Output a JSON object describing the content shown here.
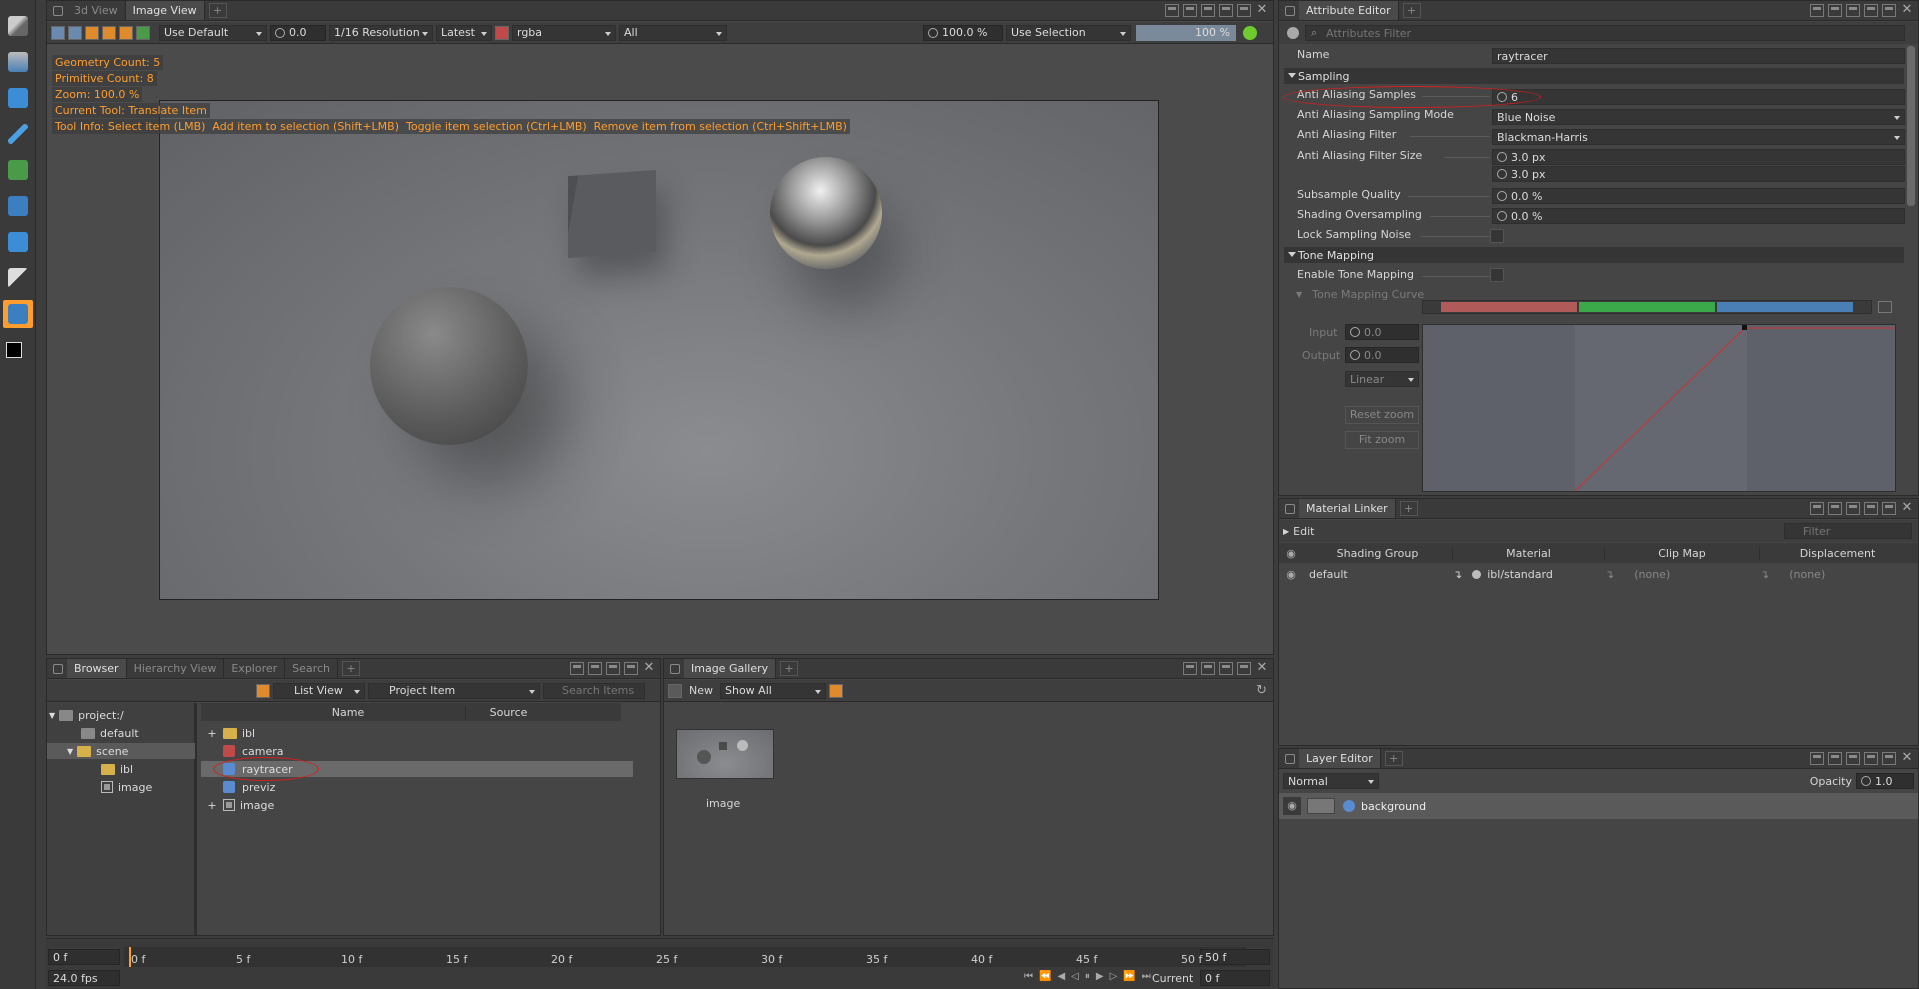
{
  "viewer": {
    "tabs": [
      "3d View",
      "Image View"
    ],
    "active_tab": "Image View",
    "toolbar": {
      "lut": "Use Default",
      "exposure": "0.0",
      "resolution": "1/16 Resolution",
      "version": "Latest",
      "channel": "rgba",
      "layer": "All",
      "zoom": "100.0 %",
      "selection": "Use Selection",
      "progress_label": "100 %",
      "progress": 1.0
    },
    "hud": {
      "geometry": "Geometry Count: 5",
      "primitive": "Primitive Count: 8",
      "zoom": "Zoom: 100.0 %",
      "current_tool": "Current Tool: Translate Item",
      "tool_info": "Tool Info: Select item (LMB)  Add item to selection (Shift+LMB)  Toggle item selection (Ctrl+LMB)  Remove item from selection (Ctrl+Shift+LMB)"
    }
  },
  "attribute_editor": {
    "title": "Attribute Editor",
    "filter_placeholder": "Attributes Filter",
    "name_label": "Name",
    "name_value": "raytracer",
    "sampling_section": "Sampling",
    "rows": [
      {
        "label": "Anti Aliasing Samples",
        "value": "6"
      },
      {
        "label": "Anti Aliasing Sampling Mode",
        "value": "Blue Noise"
      },
      {
        "label": "Anti Aliasing Filter",
        "value": "Blackman-Harris"
      },
      {
        "label": "Anti Aliasing Filter Size",
        "value": "3.0 px",
        "value2": "3.0 px"
      },
      {
        "label": "Subsample Quality",
        "value": "0.0 %"
      },
      {
        "label": "Shading Oversampling",
        "value": "0.0 %"
      },
      {
        "label": "Lock Sampling Noise"
      }
    ],
    "tone_section": "Tone Mapping",
    "enable_tone": "Enable Tone Mapping",
    "curve_section": "Tone Mapping Curve",
    "input_label": "Input",
    "input_value": "0.0",
    "output_label": "Output",
    "output_value": "0.0",
    "interp": "Linear",
    "reset_zoom": "Reset zoom",
    "fit_zoom": "Fit zoom",
    "colors": {
      "red": "#b05a5a",
      "green": "#3ba84a",
      "blue": "#4a7fb6"
    }
  },
  "material_linker": {
    "title": "Material Linker",
    "edit": "Edit",
    "filter_placeholder": "Filter",
    "headers": [
      "Shading Group",
      "Material",
      "Clip Map",
      "Displacement"
    ],
    "row": {
      "group": "default",
      "material": "ibl/standard",
      "clip": "(none)",
      "disp": "(none)"
    }
  },
  "layer_editor": {
    "title": "Layer Editor",
    "mode": "Normal",
    "opacity_label": "Opacity",
    "opacity": "1.0",
    "layer": "background"
  },
  "browser": {
    "tabs": [
      "Browser",
      "Hierarchy View",
      "Explorer",
      "Search"
    ],
    "view": "List View",
    "filter": "Project Item",
    "search_placeholder": "Search Items",
    "tree": [
      {
        "label": "project:/",
        "depth": 0
      },
      {
        "label": "default",
        "depth": 1
      },
      {
        "label": "scene",
        "depth": 1
      },
      {
        "label": "ibl",
        "depth": 2
      },
      {
        "label": "image",
        "depth": 2
      }
    ],
    "headers": [
      "Name",
      "Source"
    ],
    "items": [
      "ibl",
      "camera",
      "raytracer",
      "previz",
      "image"
    ]
  },
  "gallery": {
    "title": "Image Gallery",
    "new": "New",
    "show": "Show All",
    "thumb_label": "image"
  },
  "timeline": {
    "start": "0 f",
    "end": "50 f",
    "fps": "24.0 fps",
    "current_label": "Current",
    "current": "0 f",
    "ticks": [
      "0 f",
      "5 f",
      "10 f",
      "15 f",
      "20 f",
      "25 f",
      "30 f",
      "35 f",
      "40 f",
      "45 f",
      "50 f"
    ],
    "playhead_label": "0 f"
  }
}
